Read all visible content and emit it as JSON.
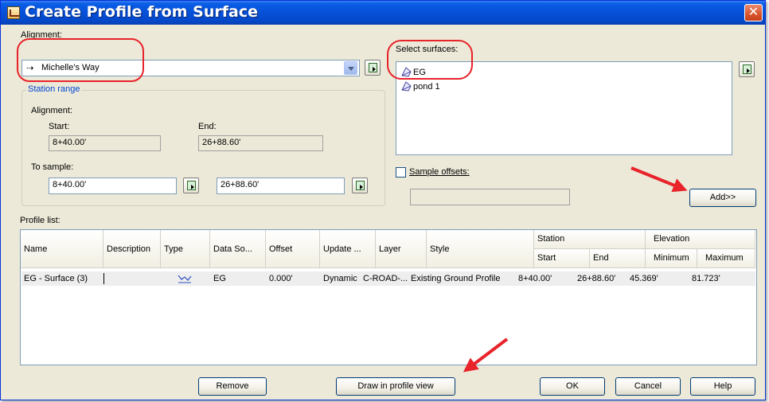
{
  "title": "Create Profile from Surface",
  "colors": {
    "accent": "#0a5ee5",
    "highlight": "#e8232a",
    "group_title": "#0046d5"
  },
  "alignment": {
    "label": "Alignment:",
    "selected": "Michelle's Way",
    "station_range": {
      "title": "Station range",
      "alignment_label": "Alignment:",
      "start_label": "Start:",
      "start_value": "8+40.00'",
      "end_label": "End:",
      "end_value": "26+88.60'",
      "to_sample_label": "To sample:",
      "sample_start": "8+40.00'",
      "sample_end": "26+88.60'"
    }
  },
  "surfaces": {
    "label": "Select surfaces:",
    "items": [
      {
        "name": "EG",
        "icon": "surface-icon"
      },
      {
        "name": "pond 1",
        "icon": "surface-icon"
      }
    ],
    "sample_offsets_label": "Sample offsets:",
    "sample_offsets_value": "",
    "add_label": "Add>>"
  },
  "profile_list": {
    "label": "Profile list:",
    "columns": [
      "Name",
      "Description",
      "Type",
      "Data So...",
      "Offset",
      "Update ...",
      "Layer",
      "Style"
    ],
    "station_group": "Station",
    "station_cols": [
      "Start",
      "End"
    ],
    "elevation_group": "Elevation",
    "elevation_cols": [
      "Minimum",
      "Maximum"
    ],
    "rows": [
      {
        "name": "EG - Surface (3)",
        "description": "",
        "type_icon": "surface-profile-icon",
        "data_source": "EG",
        "offset": "0.000'",
        "update": "Dynamic",
        "layer": "C-ROAD-...",
        "style": "Existing Ground Profile",
        "start": "8+40.00'",
        "end": "26+88.60'",
        "minimum": "45.369'",
        "maximum": "81.723'"
      }
    ]
  },
  "buttons": {
    "remove": "Remove",
    "draw": "Draw in profile view",
    "ok": "OK",
    "cancel": "Cancel",
    "help": "Help"
  }
}
